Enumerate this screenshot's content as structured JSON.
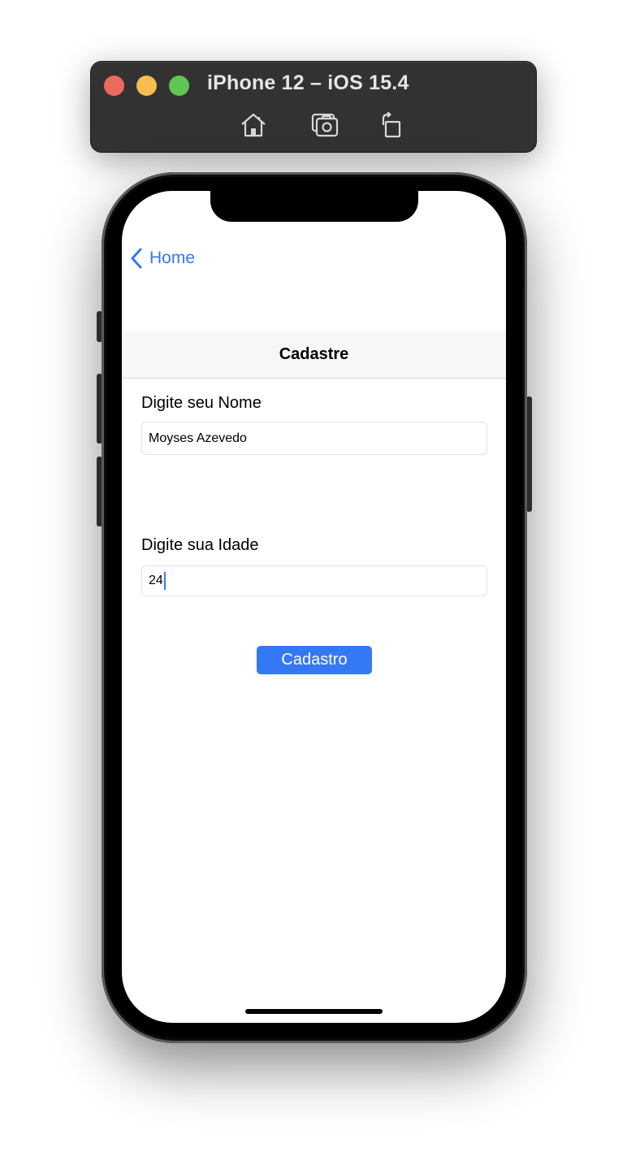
{
  "simulator": {
    "title": "iPhone 12 – iOS 15.4",
    "toolbar": {
      "home_icon": "home-icon",
      "screenshot_icon": "camera-icon",
      "rotate_icon": "rotate-icon"
    }
  },
  "app": {
    "nav": {
      "back_label": "Home"
    },
    "title": "Cadastre",
    "form": {
      "name_label": "Digite seu Nome",
      "name_value": "Moyses Azevedo",
      "age_label": "Digite sua Idade",
      "age_value": "24",
      "submit_label": "Cadastro"
    }
  },
  "colors": {
    "accent": "#3478f6",
    "traffic_red": "#ed6a5e",
    "traffic_yellow": "#f5bf4f",
    "traffic_green": "#61c554",
    "title_bar": "#323232"
  }
}
